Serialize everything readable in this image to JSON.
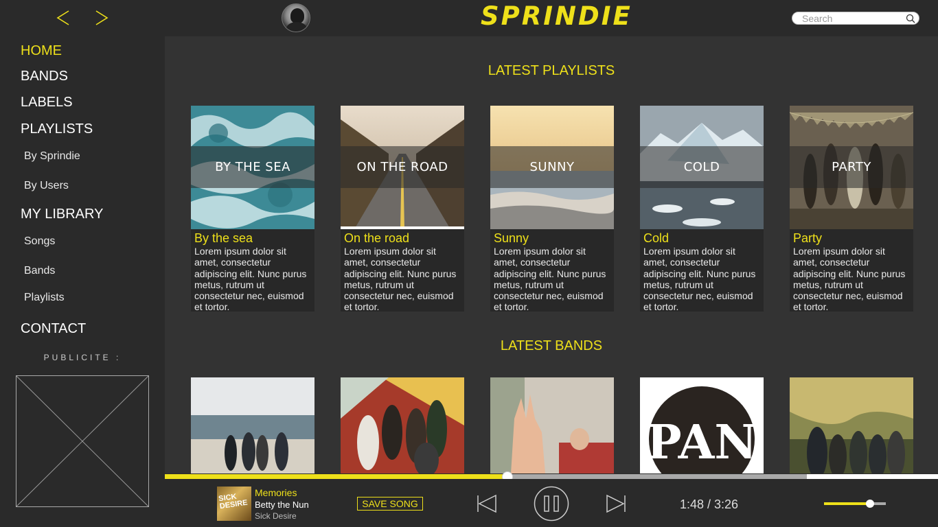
{
  "header": {
    "logo": "SPRINDIE",
    "search_placeholder": "Search"
  },
  "sidebar": {
    "home": "HOME",
    "bands": "BANDS",
    "labels": "LABELS",
    "playlists": "PLAYLISTS",
    "by_sprindie": "By Sprindie",
    "by_users": "By Users",
    "my_library": "MY LIBRARY",
    "songs": "Songs",
    "lib_bands": "Bands",
    "lib_playlists": "Playlists",
    "contact": "CONTACT",
    "ad_label": "PUBLICITE :"
  },
  "playlists_section": {
    "title": "LATEST PLAYLISTS",
    "items": [
      {
        "overlay": "BY THE SEA",
        "title": "By the sea",
        "desc": "Lorem ipsum dolor sit amet, consectetur adipiscing elit. Nunc purus metus, rutrum ut consectetur nec, euismod et tortor."
      },
      {
        "overlay": "ON THE ROAD",
        "title": "On the road",
        "desc": "Lorem ipsum dolor sit amet, consectetur adipiscing elit. Nunc purus metus, rutrum ut consectetur nec, euismod et tortor."
      },
      {
        "overlay": "SUNNY",
        "title": "Sunny",
        "desc": "Lorem ipsum dolor sit amet, consectetur adipiscing elit. Nunc purus metus, rutrum ut consectetur nec, euismod et tortor."
      },
      {
        "overlay": "COLD",
        "title": "Cold",
        "desc": "Lorem ipsum dolor sit amet, consectetur adipiscing elit. Nunc purus metus, rutrum ut consectetur nec, euismod et tortor."
      },
      {
        "overlay": "PARTY",
        "title": "Party",
        "desc": "Lorem ipsum dolor sit amet, consectetur adipiscing elit. Nunc purus metus, rutrum ut consectetur nec, euismod et tortor."
      }
    ]
  },
  "bands_section": {
    "title": "LATEST BANDS",
    "logo_text": "PAN"
  },
  "player": {
    "song_title": "Memories",
    "artist": "Betty the Nun",
    "album": "Sick Desire",
    "cover_text": "SICK DESIRE",
    "save_label": "SAVE SONG",
    "time": "1:48 / 3:26",
    "progress": 0.443,
    "volume": 0.74
  },
  "colors": {
    "accent": "#eee01a",
    "background": "#333333",
    "panel": "#2a2a2a"
  }
}
